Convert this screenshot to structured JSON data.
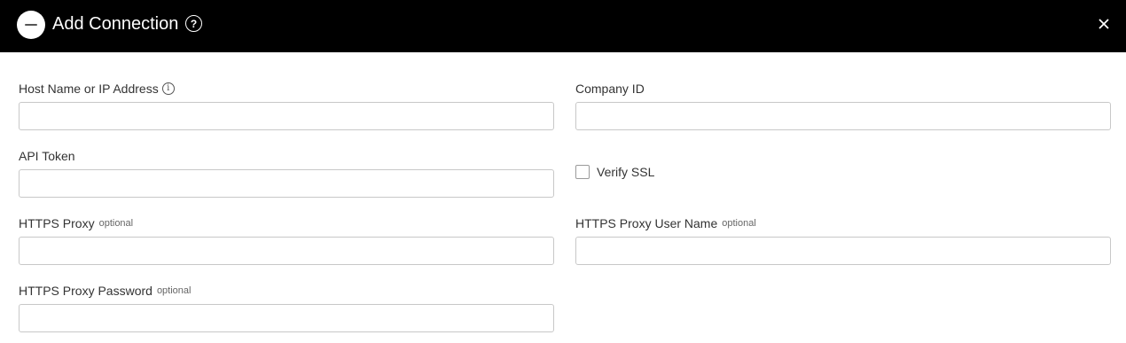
{
  "header": {
    "title": "Add Connection",
    "help_glyph": "?",
    "background": "#000000"
  },
  "form": {
    "host": {
      "label": "Host Name or IP Address",
      "value": "",
      "info_glyph": "i"
    },
    "company_id": {
      "label": "Company ID",
      "value": ""
    },
    "api_token": {
      "label": "API Token",
      "value": ""
    },
    "verify_ssl": {
      "label": "Verify SSL",
      "checked": false
    },
    "https_proxy": {
      "label": "HTTPS Proxy",
      "optional": "optional",
      "value": ""
    },
    "https_proxy_user": {
      "label": "HTTPS Proxy User Name",
      "optional": "optional",
      "value": ""
    },
    "https_proxy_password": {
      "label": "HTTPS Proxy Password",
      "optional": "optional",
      "value": ""
    }
  },
  "icons": {
    "logo": "app-logo",
    "help": "help-icon",
    "close": "close-icon",
    "info": "info-icon"
  }
}
